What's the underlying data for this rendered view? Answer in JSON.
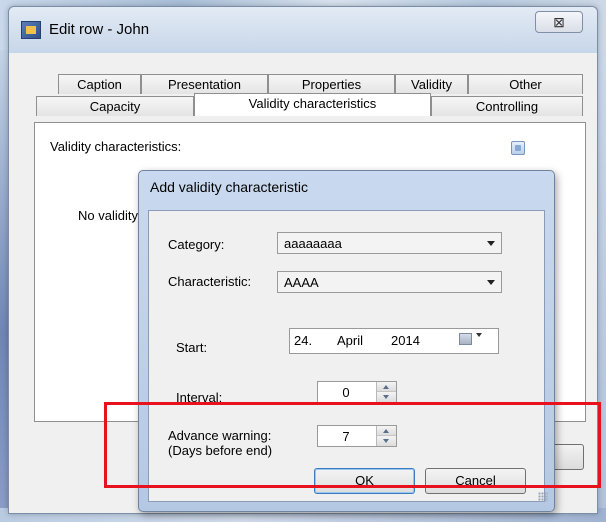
{
  "main_window": {
    "title": "Edit row - John",
    "close_label": "⊠",
    "tabs_row1": [
      "Caption",
      "Presentation",
      "Properties",
      "Validity",
      "Other"
    ],
    "tabs_row2": [
      "Capacity",
      "Validity characteristics",
      "Controlling"
    ],
    "active_tab": "Validity characteristics",
    "panel_label": "Validity characteristics:",
    "empty_text": "No validity"
  },
  "dialog": {
    "title": "Add validity characteristic",
    "category_label": "Category:",
    "category_value": "aaaaaaaa",
    "characteristic_label": "Characteristic:",
    "characteristic_value": "AAAA",
    "start_label": "Start:",
    "start_day": "24.",
    "start_month": "April",
    "start_year": "2014",
    "interval_label": "Interval:",
    "interval_value": "0",
    "advance_label": "Advance warning:",
    "advance_sublabel": "(Days before end)",
    "advance_value": "7",
    "ok_label": "OK",
    "cancel_label": "Cancel"
  },
  "colors": {
    "highlight": "#e8121f",
    "dialog_frame": "#c9d9ef"
  }
}
